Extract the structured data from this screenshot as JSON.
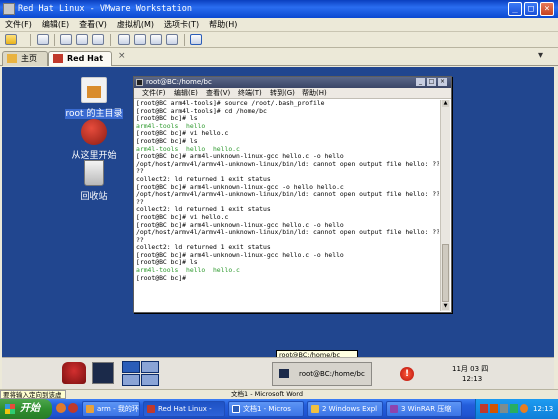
{
  "vmware": {
    "title": "Red Hat Linux - VMware Workstation",
    "menu": [
      "文件(F)",
      "编辑(E)",
      "查看(V)",
      "虚拟机(M)",
      "选项卡(T)",
      "帮助(H)"
    ],
    "tabs": [
      {
        "label": "主页",
        "icon": "home-icon"
      },
      {
        "label": "Red Hat Linux",
        "icon": "vm-icon"
      }
    ],
    "statusbar": "文档1 - Microsoft Word"
  },
  "desktop": {
    "icons": [
      {
        "label": "root 的主目录",
        "icon": "home-folder-icon"
      },
      {
        "label": "从这里开始",
        "icon": "start-here-icon"
      },
      {
        "label": "回收站",
        "icon": "trash-icon"
      }
    ]
  },
  "terminal": {
    "title": "root@BC:/home/bc",
    "menu": [
      "文件(F)",
      "编辑(E)",
      "查看(V)",
      "终端(T)",
      "转到(G)",
      "帮助(H)"
    ],
    "lines": [
      [
        {
          "t": "[root@BC arm4l-tools]# source /root/.bash_profile",
          "c": ""
        }
      ],
      [
        {
          "t": "[root@BC arm4l-tools]# cd /home/bc",
          "c": ""
        }
      ],
      [
        {
          "t": "[root@BC bc]# ls",
          "c": ""
        }
      ],
      [
        {
          "t": "arm4l-tools  hello",
          "c": "g"
        }
      ],
      [
        {
          "t": "[root@BC bc]# vi hello.c",
          "c": ""
        }
      ],
      [
        {
          "t": "[root@BC bc]# ls",
          "c": ""
        }
      ],
      [
        {
          "t": "arm4l-tools  hello  hello.c",
          "c": "g"
        }
      ],
      [
        {
          "t": "[root@BC bc]# arm4l-unknown-linux-gcc hello.c -o hello",
          "c": ""
        }
      ],
      [
        {
          "t": "/opt/host/armv4l/armv4l-unknown-linux/bin/ld: cannot open output file hello: ???",
          "c": ""
        }
      ],
      [
        {
          "t": "??",
          "c": ""
        }
      ],
      [
        {
          "t": "collect2: ld returned 1 exit status",
          "c": ""
        }
      ],
      [
        {
          "t": "[root@BC bc]# arm4l-unknown-linux-gcc -o hello hello.c",
          "c": ""
        }
      ],
      [
        {
          "t": "/opt/host/armv4l/armv4l-unknown-linux/bin/ld: cannot open output file hello: ???",
          "c": ""
        }
      ],
      [
        {
          "t": "??",
          "c": ""
        }
      ],
      [
        {
          "t": "collect2: ld returned 1 exit status",
          "c": ""
        }
      ],
      [
        {
          "t": "[root@BC bc]# vi hello.c",
          "c": ""
        }
      ],
      [
        {
          "t": "[root@BC bc]# arm4l-unknown-linux-gcc hello.c -o hello",
          "c": ""
        }
      ],
      [
        {
          "t": "/opt/host/armv4l/armv4l-unknown-linux/bin/ld: cannot open output file hello: ???",
          "c": ""
        }
      ],
      [
        {
          "t": "??",
          "c": ""
        }
      ],
      [
        {
          "t": "collect2: ld returned 1 exit status",
          "c": ""
        }
      ],
      [
        {
          "t": "[root@BC bc]# arm4l-unknown-linux-gcc hello.c -o hello",
          "c": ""
        }
      ],
      [
        {
          "t": "[root@BC bc]# ls",
          "c": ""
        }
      ],
      [
        {
          "t": "arm4l-tools  hello  hello.c",
          "c": "g"
        }
      ],
      [
        {
          "t": "[root@BC bc]# ",
          "c": ""
        }
      ]
    ]
  },
  "panel": {
    "tooltip": "root@BC:/home/bc",
    "task_label": "root@BC:/home/bc",
    "date": "11月 03 四",
    "time": "12:13"
  },
  "taskbar": {
    "start": "开始",
    "input_hint": "要将输入定向到该虚拟",
    "tasks": [
      {
        "label": "arm - 我的环境",
        "color": "#e8a13a"
      },
      {
        "label": "Red Hat Linux -",
        "color": "#c0392b"
      },
      {
        "label": "文档1 - Micros",
        "color": "#2b5db8"
      },
      {
        "label": "2 Windows Expl",
        "color": "#f0c040"
      },
      {
        "label": "3 WinRAR 压缩",
        "color": "#8e44ad"
      }
    ],
    "clock": "12:13"
  },
  "colors": {
    "desktop": "#21468f",
    "taskbar": "#245edb",
    "start": "#2f8f2f"
  }
}
